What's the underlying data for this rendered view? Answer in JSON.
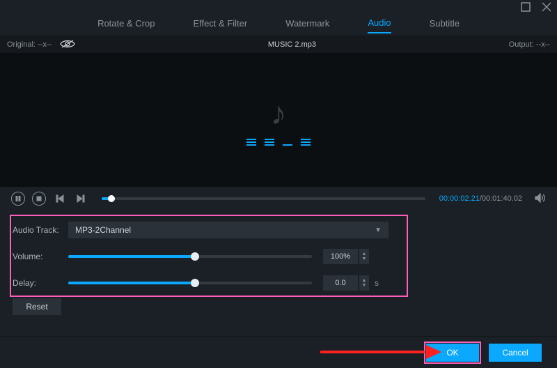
{
  "tabs": [
    "Rotate & Crop",
    "Effect & Filter",
    "Watermark",
    "Audio",
    "Subtitle"
  ],
  "active_tab": 3,
  "status": {
    "original": "Original:  --x--",
    "filename": "MUSIC 2.mp3",
    "output": "Output:  --x--"
  },
  "transport": {
    "current": "00:00:02.21",
    "total": "/00:01:40.02"
  },
  "panel": {
    "track_label": "Audio Track:",
    "track_value": "MP3-2Channel",
    "volume_label": "Volume:",
    "volume_value": "100%",
    "delay_label": "Delay:",
    "delay_value": "0.0",
    "delay_unit": "s",
    "reset": "Reset"
  },
  "footer": {
    "ok": "OK",
    "cancel": "Cancel"
  }
}
